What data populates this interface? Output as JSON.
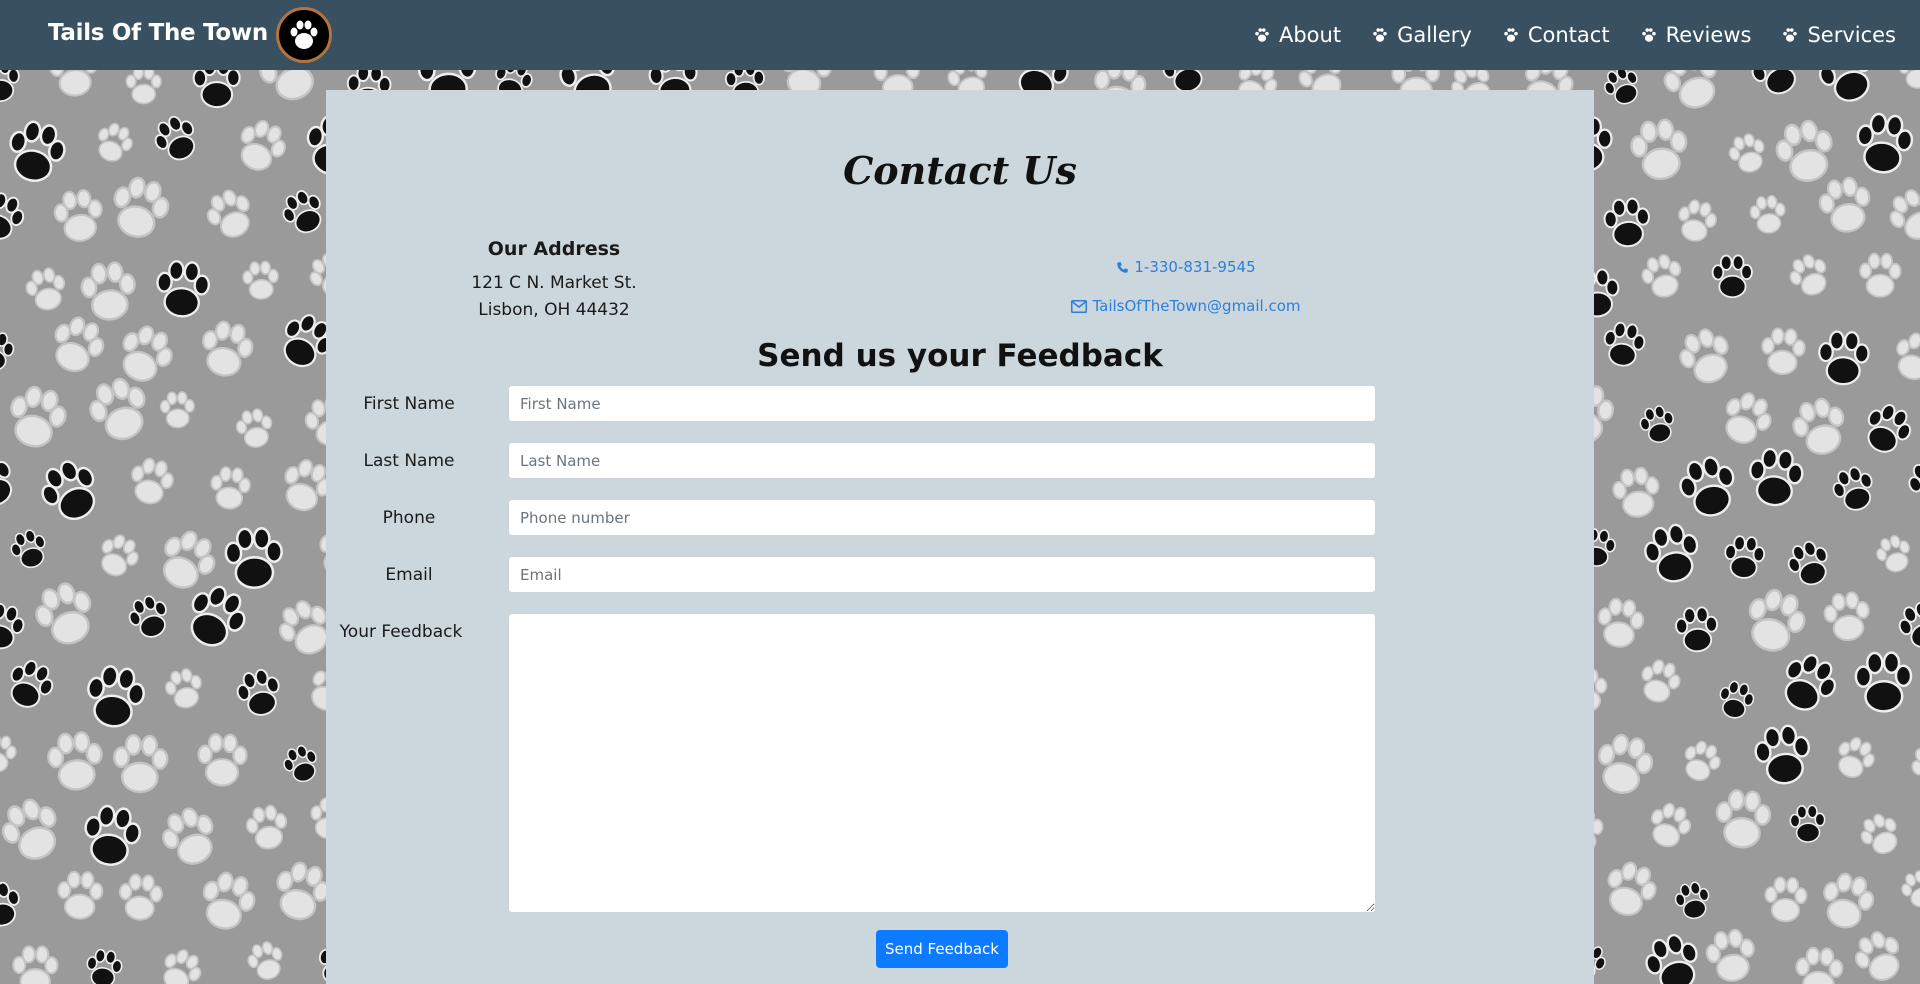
{
  "navbar": {
    "brand": "Tails Of The Town",
    "items": [
      {
        "label": "About",
        "icon": "paw-icon"
      },
      {
        "label": "Gallery",
        "icon": "paw-icon"
      },
      {
        "label": "Contact",
        "icon": "paw-icon"
      },
      {
        "label": "Reviews",
        "icon": "paw-icon"
      },
      {
        "label": "Services",
        "icon": "paw-icon"
      }
    ]
  },
  "contact": {
    "title": "Contact Us",
    "address_heading": "Our Address",
    "address_line1": "121 C N. Market St.",
    "address_line2": "Lisbon, OH 44432",
    "phone": "1-330-831-9545",
    "email": "TailsOfTheTown@gmail.com"
  },
  "feedback": {
    "title": "Send us your Feedback",
    "first_name_label": "First Name",
    "first_name_placeholder": "First Name",
    "last_name_label": "Last Name",
    "last_name_placeholder": "Last Name",
    "phone_label": "Phone",
    "phone_placeholder": "Phone number",
    "email_label": "Email",
    "email_placeholder": "Email",
    "feedback_label": "Your Feedback",
    "submit_label": "Send Feedback"
  },
  "colors": {
    "navbar": "#38505f",
    "panel": "#cbd7dd",
    "link": "#2e7fd9",
    "button": "#0d7bff"
  }
}
